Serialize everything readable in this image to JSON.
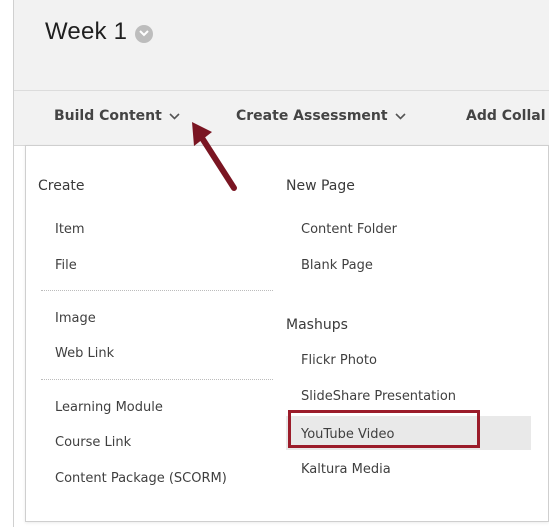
{
  "page": {
    "title": "Week 1"
  },
  "action_bar": {
    "build_content": "Build Content",
    "create_assessment": "Create Assessment",
    "add_collab": "Add Collal"
  },
  "dropdown": {
    "left_column": {
      "header": "Create",
      "groups": [
        [
          "Item",
          "File"
        ],
        [
          "Image",
          "Web Link"
        ],
        [
          "Learning Module",
          "Course Link",
          "Content Package (SCORM)"
        ]
      ]
    },
    "right_column": {
      "new_page": {
        "header": "New Page",
        "items": [
          "Content Folder",
          "Blank Page"
        ]
      },
      "mashups": {
        "header": "Mashups",
        "items": [
          "Flickr Photo",
          "SlideShare Presentation",
          "YouTube Video",
          "Kaltura Media"
        ]
      }
    },
    "highlighted_item": "YouTube Video"
  },
  "colors": {
    "accent_arrow": "#7a1522",
    "highlight_border": "#9b1c2a",
    "bar_background": "#f2f2f2",
    "highlight_background": "#e9e9e9"
  },
  "icons": [
    "chevron-down-icon",
    "arrow-annotation-icon"
  ]
}
